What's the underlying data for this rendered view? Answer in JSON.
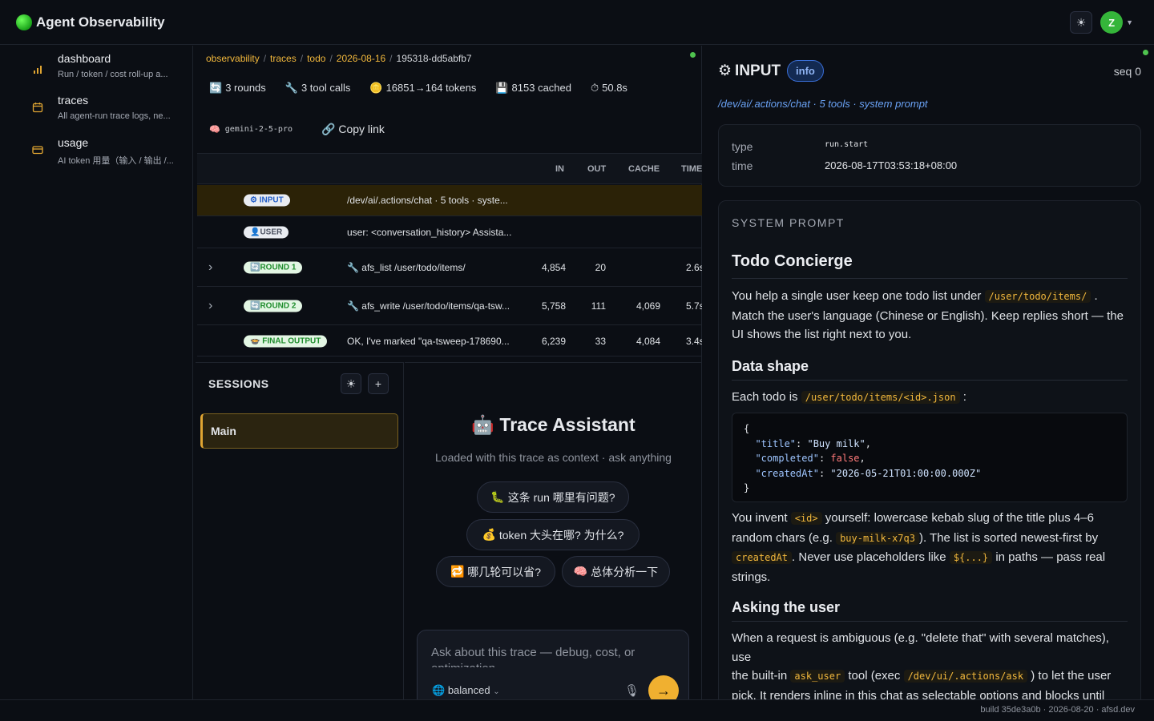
{
  "app": {
    "title": "Agent Observability",
    "avatar_initial": "Z"
  },
  "sidebar": {
    "items": [
      {
        "title": "dashboard",
        "desc": "Run / token / cost roll-up a...",
        "icon": "bar-chart-icon"
      },
      {
        "title": "traces",
        "desc": "All agent-run trace logs, ne...",
        "icon": "calendar-icon"
      },
      {
        "title": "usage",
        "desc": "AI token 用量（输入 / 输出 /...",
        "icon": "card-icon"
      }
    ]
  },
  "breadcrumb": {
    "items": [
      "observability",
      "traces",
      "todo",
      "2026-08-16"
    ],
    "current": "195318-dd5abfb7"
  },
  "stats": {
    "rounds": "3 rounds",
    "tool_calls": "3 tool calls",
    "tokens": "16851→164 tokens",
    "cached": "8153 cached",
    "duration": "50.8s"
  },
  "model": {
    "name": "gemini-2-5-pro",
    "copy_link": "Copy link"
  },
  "table": {
    "headers": {
      "in": "IN",
      "out": "OUT",
      "cache": "CACHE",
      "time": "TIME"
    },
    "rows": [
      {
        "badge": "INPUT",
        "text": "/dev/ai/.actions/chat · 5 tools · syste...",
        "in": "",
        "out": "",
        "cache": "",
        "time": ""
      },
      {
        "badge": "USER",
        "text": "user: <conversation_history> Assista...",
        "in": "",
        "out": "",
        "cache": "",
        "time": ""
      },
      {
        "badge": "ROUND 1",
        "text": "afs_list /user/todo/items/",
        "in": "4,854",
        "out": "20",
        "cache": "",
        "time": "2.6s"
      },
      {
        "badge": "ROUND 2",
        "text": "afs_write /user/todo/items/qa-tsw...",
        "in": "5,758",
        "out": "111",
        "cache": "4,069",
        "time": "5.7s"
      },
      {
        "badge": "FINAL OUTPUT",
        "text": "OK, I've marked \"qa-tsweep-178690...",
        "in": "6,239",
        "out": "33",
        "cache": "4,084",
        "time": "3.4s"
      }
    ]
  },
  "sessions": {
    "title": "SESSIONS",
    "items": [
      "Main"
    ]
  },
  "assistant": {
    "title": "Trace Assistant",
    "subtitle": "Loaded with this trace as context · ask anything",
    "chips": [
      "这条 run 哪里有问题?",
      "token 大头在哪? 为什么?",
      "哪几轮可以省?",
      "总体分析一下"
    ],
    "placeholder": "Ask about this trace — debug, cost, or optimization",
    "mode": "balanced"
  },
  "detail": {
    "title": "INPUT",
    "badge": "info",
    "seq": "seq 0",
    "subtitle": "/dev/ai/.actions/chat · 5 tools · system prompt",
    "meta": {
      "type_label": "type",
      "type_value": "run.start",
      "time_label": "time",
      "time_value": "2026-08-17T03:53:18+08:00"
    },
    "prompt": {
      "label": "SYSTEM PROMPT",
      "h1": "Todo Concierge",
      "p1_a": "You help a single user keep one todo list under",
      "p1_code": "/user/todo/items/",
      "p1_b": ". Match the user's language (Chinese or English). Keep replies short — the UI shows the list right next to you.",
      "h2_shape": "Data shape",
      "p2_a": "Each todo is",
      "p2_code": "/user/todo/items/<id>.json",
      "p2_b": ":",
      "code": {
        "k_title": "\"title\"",
        "v_title": "\"Buy milk\"",
        "k_completed": "\"completed\"",
        "v_completed": "false",
        "k_created": "\"createdAt\"",
        "v_created": "\"2026-05-21T01:00:00.000Z\""
      },
      "p3_a": "You invent",
      "p3_code1": "<id>",
      "p3_b": "yourself: lowercase kebab slug of the title plus 4–6 random chars (e.g.",
      "p3_code2": "buy-milk-x7q3",
      "p3_c": "). The list is sorted newest-first by",
      "p3_code3": "createdAt",
      "p3_d": ". Never use placeholders like",
      "p3_code4": "${...}",
      "p3_e": "in paths — pass real strings.",
      "h2_ask": "Asking the user",
      "p4_a": "When a request is ambiguous (e.g. \"delete that\" with several matches), use",
      "p4_b": "the built-in",
      "p4_code1": "ask_user",
      "p4_c": "tool (exec",
      "p4_code2": "/dev/ui/.actions/ask",
      "p4_d": ") to let the user pick. It renders inline in this chat as selectable options and blocks until"
    }
  },
  "footer": {
    "text": "build 35de3a0b · 2026-08-20 · afsd.dev"
  }
}
